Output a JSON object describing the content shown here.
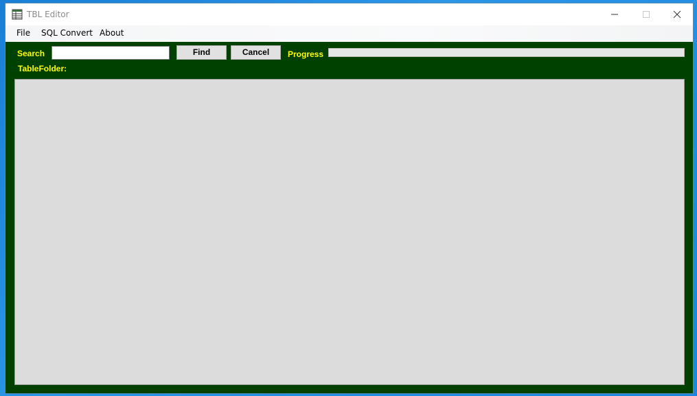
{
  "window": {
    "title": "TBL Editor",
    "icon": "spreadsheet-icon"
  },
  "menu": {
    "items": [
      {
        "label": "File"
      },
      {
        "label": "SQL Convert"
      },
      {
        "label": "About"
      }
    ]
  },
  "toolbar": {
    "search_label": "Search",
    "search_value": "",
    "find_label": "Find",
    "cancel_label": "Cancel",
    "progress_label": "Progress",
    "progress_value": 0,
    "table_folder_label": "TableFolder:"
  },
  "colors": {
    "window_background": "#004100",
    "label_color": "#ffff00",
    "panel_background": "#dcdcdc",
    "desktop_background": "#1a7fd6"
  },
  "icons": {
    "minimize": "minimize-icon",
    "maximize": "maximize-icon",
    "close": "close-icon"
  }
}
